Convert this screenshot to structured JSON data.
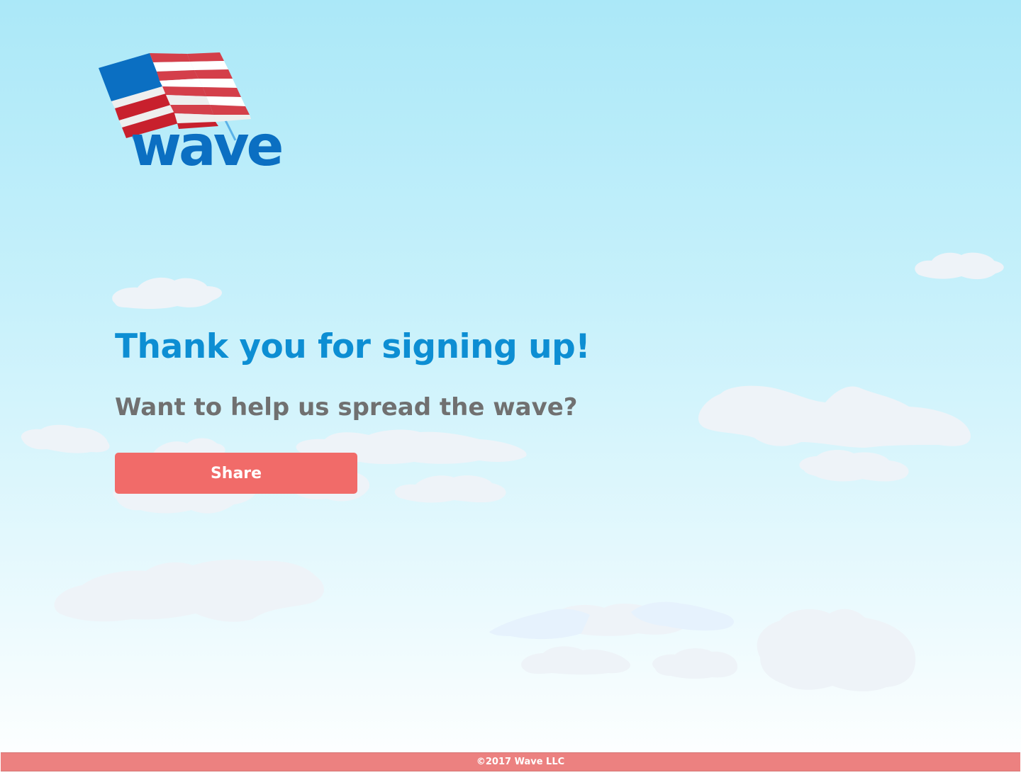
{
  "brand": {
    "logo_text": "wave",
    "colors": {
      "primary_blue": "#0b6fc2",
      "headline_blue": "#0d8ed3",
      "flag_red": "#d43f4a",
      "accent_coral": "#f16b69",
      "footer_coral": "#ec8180"
    }
  },
  "main": {
    "headline": "Thank you for signing up!",
    "subheadline": "Want to help us spread the wave?",
    "share_button_label": "Share"
  },
  "footer": {
    "copyright": "©2017 Wave LLC"
  },
  "icons": {
    "logo": "us-flag-wave-logo",
    "background": "cloud-sky-background"
  }
}
